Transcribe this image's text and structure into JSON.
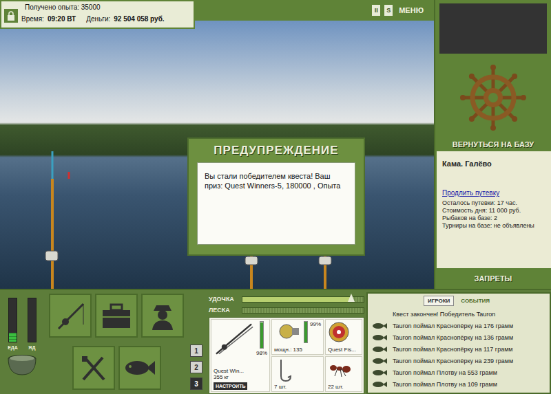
{
  "hud": {
    "experience": "Получено опыта: 35000",
    "time_label": "Время:",
    "time": "09:20 ВТ",
    "money_label": "Деньги:",
    "money": "92 504 058 руб."
  },
  "toolbar": {
    "buttons": [
      "II",
      "S",
      "МЕНЮ"
    ]
  },
  "dialog": {
    "title": "ПРЕДУПРЕЖДЕНИЕ",
    "message": "Вы стали победителем квеста! Ваш приз: Quest Winners-5, 180000 , Опыта"
  },
  "base": {
    "return_button": "ВЕРНУТЬСЯ НА БАЗУ",
    "location": "Кама. Галёво",
    "extend_link": "Продлить путевку",
    "info": [
      "Осталось путевки: 17 час.",
      "Стоимость дня: 11 000 руб.",
      "Рыбаков на базе: 2",
      "Турниры на базе: не объявлены"
    ],
    "bans_button": "ЗАПРЕТЫ"
  },
  "meters": [
    {
      "label": "ЕДА",
      "level": 0.2
    },
    {
      "label": "ЯД",
      "level": 0
    }
  ],
  "pages": [
    {
      "label": "1",
      "selected": false
    },
    {
      "label": "2",
      "selected": false
    },
    {
      "label": "3",
      "selected": true
    }
  ],
  "tension": [
    {
      "label": "УДОЧКА",
      "level": 0.9
    },
    {
      "label": "ЛЕСКА",
      "level": 0
    }
  ],
  "tackle": {
    "rod": {
      "name": "Quest Win...",
      "weight": "355 кг",
      "wear": "98%",
      "level": 0.98,
      "button": "НАСТРОИТЬ"
    },
    "reel": {
      "power": "мощн.: 135",
      "wear": "99%",
      "level": 0.99
    },
    "line": {
      "name": "Quest Fis..."
    },
    "hook": {
      "count": "7 шт."
    },
    "bait": {
      "count": "22 шт."
    }
  },
  "log": {
    "tabs": [
      {
        "label": "ИГРОКИ",
        "selected": true
      },
      {
        "label": "СОБЫТИЯ",
        "selected": false
      }
    ],
    "rows": [
      {
        "kind": "notice",
        "text": "Квест закончен! Победитель Tauron"
      },
      {
        "kind": "catch",
        "text": "Tauron поймал Краснопёрку на 176 грамм"
      },
      {
        "kind": "catch",
        "text": "Tauron поймал Краснопёрку на 136 грамм"
      },
      {
        "kind": "catch",
        "text": "Tauron поймал Краснопёрку на 117 грамм"
      },
      {
        "kind": "catch",
        "text": "Tauron поймал Краснопёрку на 239 грамм"
      },
      {
        "kind": "catch",
        "text": "Tauron поймал Плотву на 553 грамм"
      },
      {
        "kind": "catch",
        "text": "Tauron поймал Плотву на 109 грамм"
      }
    ]
  }
}
